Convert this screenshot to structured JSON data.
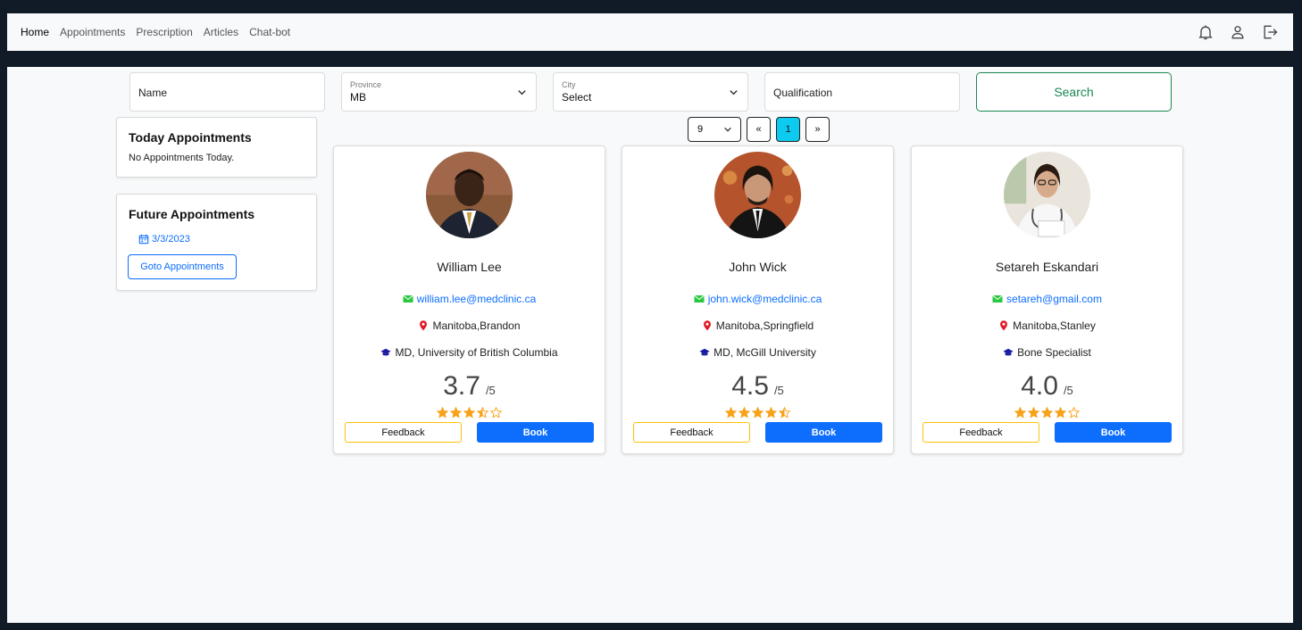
{
  "nav": {
    "links": [
      "Home",
      "Appointments",
      "Prescription",
      "Articles",
      "Chat-bot"
    ],
    "icons": [
      "bell-icon",
      "user-icon",
      "logout-icon"
    ]
  },
  "filters": {
    "name_placeholder": "Name",
    "province_label": "Province",
    "province_value": "MB",
    "city_label": "City",
    "city_value": "Select",
    "qualification_placeholder": "Qualification",
    "search_label": "Search"
  },
  "today": {
    "title": "Today Appointments",
    "text": "No Appointments Today."
  },
  "future": {
    "title": "Future Appointments",
    "date": "3/3/2023",
    "goto_label": "Goto Appointments"
  },
  "pagination": {
    "page_size": "9",
    "prev": "«",
    "current": "1",
    "next": "»"
  },
  "doctors": [
    {
      "name": "William Lee",
      "email": "william.lee@medclinic.ca",
      "location": "Manitoba,Brandon",
      "qualification": "MD, University of British Columbia",
      "rating": "3.7",
      "rating_out_of": "/5",
      "stars": 3.5,
      "feedback_label": "Feedback",
      "book_label": "Book"
    },
    {
      "name": "John Wick",
      "email": "john.wick@medclinic.ca",
      "location": "Manitoba,Springfield",
      "qualification": "MD, McGill University",
      "rating": "4.5",
      "rating_out_of": "/5",
      "stars": 4.5,
      "feedback_label": "Feedback",
      "book_label": "Book"
    },
    {
      "name": "Setareh Eskandari",
      "email": "setareh@gmail.com",
      "location": "Manitoba,Stanley",
      "qualification": "Bone Specialist",
      "rating": "4.0",
      "rating_out_of": "/5",
      "stars": 4,
      "feedback_label": "Feedback",
      "book_label": "Book"
    }
  ],
  "colors": {
    "star": "#f7a21b",
    "primary": "#0d6efd",
    "success": "#198754",
    "page_active": "#0dcaf0",
    "email_icon": "#28c840",
    "location_icon": "#e01b24",
    "qualification_icon": "#1a1aa0"
  }
}
